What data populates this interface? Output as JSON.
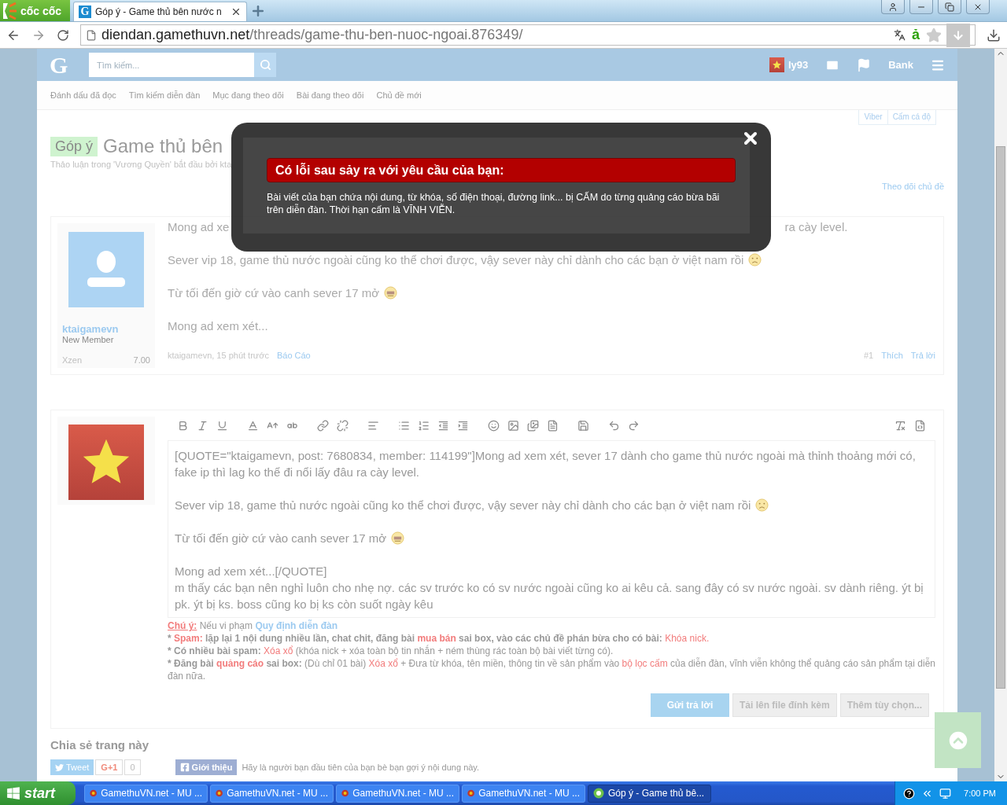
{
  "browser": {
    "brand": "cốc cốc",
    "tabs": [
      {
        "favicon": "G",
        "label": "Góp ý - Game thủ bên nước n",
        "selected": true
      }
    ],
    "url": {
      "host": "diendan.gamethuvn.net",
      "path": "/threads/game-thu-ben-nuoc-ngoai.876349/"
    },
    "ime_indicator": "ả"
  },
  "site_header": {
    "logo": "G",
    "search": {
      "placeholder": "Tìm kiếm..."
    },
    "username": "ly93",
    "bank": "Bank"
  },
  "subnav": [
    "Đánh dấu đã đọc",
    "Tìm kiếm diễn đàn",
    "Mục đang theo dõi",
    "Bài đang theo dõi",
    "Chủ đề mới"
  ],
  "thread": {
    "prefix": "Góp ý",
    "title": "Game thủ bên",
    "meta": "Thảo luận trong 'Vương Quyền' bắt đầu bởi kta",
    "tags": [
      "Viber",
      "Cấm cá độ"
    ],
    "follow": "Theo dõi chủ đề"
  },
  "post": {
    "author": "ktaigamevn",
    "role": "New Member",
    "stat_label": "Xzen",
    "stat_value": "7.00",
    "paragraphs": [
      {
        "kind": "split",
        "text": "Mong ad xe",
        "text_end": "ra cày level."
      },
      {
        "kind": "sad-emoji",
        "text": "Sever vip 18, game thủ nước ngoài cũng ko thể chơi được, vậy sever này chỉ dành cho các bạn ở việt nam rồi"
      },
      {
        "kind": "sleepy-emoji",
        "text": "Từ tối đến giờ cứ vào canh sever 17 mở"
      },
      {
        "kind": "plain",
        "text": "Mong ad xem xét..."
      }
    ],
    "byline": "ktaigamevn, 15 phút trước",
    "report": "Báo Cáo",
    "number": "#1",
    "like": "Thích",
    "reply": "Trả lời"
  },
  "editor": {
    "paragraphs": [
      {
        "lines": [
          "[QUOTE=\"ktaigamevn, post: 7680834, member: 114199\"]Mong ad xem xét, sever 17 dành cho game thủ nước ngoài mà thỉnh thoảng mới có, fake ip thì lag ko thể đi nổi lấy đâu ra cày level."
        ]
      },
      {
        "lines": [
          "Sever vip 18, game thủ nước ngoài cũng ko thể chơi được, vậy sever này chỉ dành cho các bạn ở việt nam rồi"
        ],
        "kind": "sad-emoji"
      },
      {
        "lines": [
          "Từ tối đến giờ cứ vào canh sever 17 mở"
        ],
        "kind": "sleepy-emoji"
      },
      {
        "lines": [
          "Mong ad xem xét...[/QUOTE]",
          "m thấy các bạn nên nghỉ luôn cho nhẹ nợ. các sv trước ko có sv nước ngoài cũng ko ai kêu cả. sang đây có sv nước ngoài. sv dành riêng. ýt bị pk. ýt bị ks. boss cũng ko bị ks còn suốt ngày kêu"
        ]
      }
    ],
    "rules": [
      [
        {
          "text": "Chú ý:",
          "kind": "label"
        },
        {
          "text": " Nếu vi phạm ",
          "kind": "plain"
        },
        {
          "text": "Quy định diễn đàn",
          "kind": "link"
        }
      ],
      [
        {
          "text": "* ",
          "kind": "bold"
        },
        {
          "text": "Spam:",
          "kind": "red-bold"
        },
        {
          "text": " lặp lại 1 nội dung nhiều lần, chat chit, đăng bài ",
          "kind": "bold"
        },
        {
          "text": "mua bán",
          "kind": "red-bold"
        },
        {
          "text": " sai box, vào các chủ đề phán bừa cho có bài: ",
          "kind": "bold"
        },
        {
          "text": "Khóa nick.",
          "kind": "red"
        }
      ],
      [
        {
          "text": "* Có nhiều bài spam: ",
          "kind": "bold"
        },
        {
          "text": "Xóa xổ",
          "kind": "red"
        },
        {
          "text": " (khóa nick + xóa toàn bộ tin nhắn + ném thùng rác toàn bộ bài viết từng có).",
          "kind": "plain"
        }
      ],
      [
        {
          "text": "* Đăng bài ",
          "kind": "bold"
        },
        {
          "text": "quảng cáo",
          "kind": "red-bold"
        },
        {
          "text": " sai box:",
          "kind": "bold"
        },
        {
          "text": " (Dù chỉ 01 bài) ",
          "kind": "plain"
        },
        {
          "text": "Xóa xổ",
          "kind": "red"
        },
        {
          "text": " + Đưa từ khóa, tên miền, thông tin về sản phẩm vào ",
          "kind": "plain"
        },
        {
          "text": "bộ lọc cấm",
          "kind": "red"
        },
        {
          "text": " của diễn đàn, vĩnh viễn không thể quảng cáo sản phẩm tại diễn đàn nữa.",
          "kind": "plain"
        }
      ]
    ],
    "buttons": [
      {
        "label": "Gửi trả lời",
        "kind": "primary"
      },
      {
        "label": "Tải lên file đính kèm",
        "kind": "secondary"
      },
      {
        "label": "Thêm tùy chọn...",
        "kind": "secondary"
      }
    ]
  },
  "share": {
    "title": "Chia sẻ trang này",
    "tweet": "Tweet",
    "gplus": "G+1",
    "gplus_count": "0",
    "facebook": "Giới thiệu",
    "facebook_text": "Hãy là người bạn đầu tiên của bạn bè bạn gợi ý nội dung này."
  },
  "modal": {
    "title": "Có lỗi sau sảy ra với yêu cầu của bạn:",
    "message": "Bài viết của bạn chứa nội dung, từ khóa, số điện thoại, đường link... bị CẤM do từng quảng cáo bừa bãi trên diễn đàn. Thời hạn cấm là VĨNH VIỄN."
  },
  "taskbar": {
    "start": "start",
    "items": [
      {
        "label": "GamethuVN.net - MU ...",
        "kind": "game",
        "selected": false
      },
      {
        "label": "GamethuVN.net - MU ...",
        "kind": "game",
        "selected": false
      },
      {
        "label": "GamethuVN.net - MU ...",
        "kind": "game",
        "selected": false
      },
      {
        "label": "GamethuVN.net - MU ...",
        "kind": "game",
        "selected": false
      },
      {
        "label": "Góp ý - Game thủ bê...",
        "kind": "browser",
        "selected": true
      }
    ],
    "time": "7:00 PM"
  }
}
